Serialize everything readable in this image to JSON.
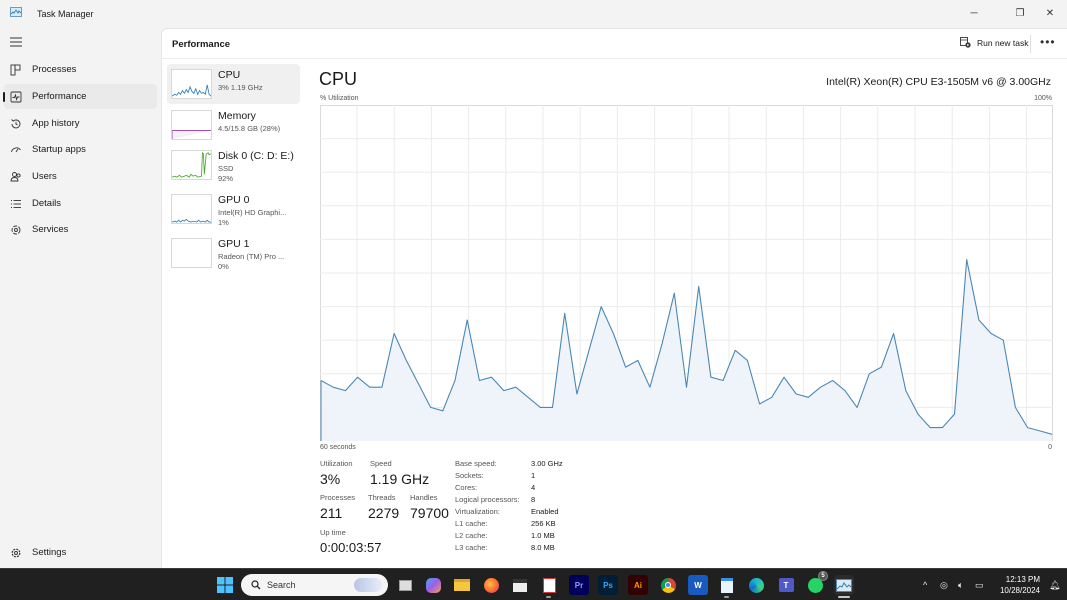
{
  "window": {
    "title": "Task Manager",
    "controls": {
      "minimize": "─",
      "maximize": "❐",
      "close": "✕"
    }
  },
  "sidebar": {
    "menu_icon": "hamburger-icon",
    "items": [
      {
        "label": "Processes",
        "icon": "processes-icon",
        "active": false
      },
      {
        "label": "Performance",
        "icon": "performance-icon",
        "active": true
      },
      {
        "label": "App history",
        "icon": "history-icon",
        "active": false
      },
      {
        "label": "Startup apps",
        "icon": "startup-icon",
        "active": false
      },
      {
        "label": "Users",
        "icon": "users-icon",
        "active": false
      },
      {
        "label": "Details",
        "icon": "details-icon",
        "active": false
      },
      {
        "label": "Services",
        "icon": "services-icon",
        "active": false
      }
    ],
    "settings_label": "Settings"
  },
  "header": {
    "title": "Performance",
    "run_new_task": "Run new task",
    "more": "•••"
  },
  "devices": [
    {
      "name": "CPU",
      "line1": "3%  1.19 GHz",
      "line2": "",
      "color": "#2f7fb6"
    },
    {
      "name": "Memory",
      "line1": "4.5/15.8 GB (28%)",
      "line2": "",
      "color": "#8b3a9e"
    },
    {
      "name": "Disk 0 (C: D: E:)",
      "line1": "SSD",
      "line2": "92%",
      "color": "#4ca82c"
    },
    {
      "name": "GPU 0",
      "line1": "Intel(R) HD Graphi...",
      "line2": "1%",
      "color": "#2f7fb6"
    },
    {
      "name": "GPU 1",
      "line1": "Radeon (TM) Pro ...",
      "line2": "0%",
      "color": "#2f7fb6"
    }
  ],
  "cpu": {
    "title": "CPU",
    "model": "Intel(R) Xeon(R) CPU E3-1505M v6 @ 3.00GHz",
    "stats": {
      "utilization_label": "Utilization",
      "utilization": "3%",
      "speed_label": "Speed",
      "speed": "1.19 GHz",
      "processes_label": "Processes",
      "processes": "211",
      "threads_label": "Threads",
      "threads": "2279",
      "handles_label": "Handles",
      "handles": "79700",
      "uptime_label": "Up time",
      "uptime": "0:00:03:57"
    },
    "specs": [
      {
        "label": "Base speed:",
        "value": "3.00 GHz"
      },
      {
        "label": "Sockets:",
        "value": "1"
      },
      {
        "label": "Cores:",
        "value": "4"
      },
      {
        "label": "Logical processors:",
        "value": "8"
      },
      {
        "label": "Virtualization:",
        "value": "Enabled"
      },
      {
        "label": "L1 cache:",
        "value": "256 KB"
      },
      {
        "label": "L2 cache:",
        "value": "1.0 MB"
      },
      {
        "label": "L3 cache:",
        "value": "8.0 MB"
      }
    ]
  },
  "chart_data": {
    "type": "area",
    "title": "CPU",
    "ylabel": "% Utilization",
    "ymax_label": "100%",
    "xlabel_left": "60 seconds",
    "xlabel_right": "0",
    "ylim": [
      0,
      100
    ],
    "xlim": [
      60,
      0
    ],
    "grid": true,
    "line_color": "#4a88b5",
    "fill_color": "#eef4fa",
    "series": [
      {
        "name": "CPU utilization",
        "x_seconds_ago": [
          60,
          59,
          58,
          57,
          56,
          55,
          54,
          53,
          52,
          51,
          50,
          49,
          48,
          47,
          46,
          45,
          44,
          43,
          42,
          41,
          40,
          39,
          38,
          37,
          36,
          35,
          34,
          33,
          32,
          31,
          30,
          29,
          28,
          27,
          26,
          25,
          24,
          23,
          22,
          21,
          20,
          19,
          18,
          17,
          16,
          15,
          14,
          13,
          12,
          11,
          10,
          9,
          8,
          7,
          6,
          5,
          4,
          3,
          2,
          1,
          0
        ],
        "values": [
          18,
          16,
          15,
          19,
          16,
          16,
          32,
          24,
          17,
          10,
          9,
          18,
          36,
          18,
          19,
          15,
          16,
          13,
          10,
          10,
          38,
          14,
          27,
          40,
          32,
          22,
          24,
          16,
          29,
          44,
          16,
          46,
          19,
          18,
          27,
          24,
          11,
          13,
          19,
          14,
          13,
          16,
          18,
          15,
          10,
          20,
          22,
          32,
          15,
          8,
          4,
          4,
          8,
          54,
          36,
          32,
          30,
          10,
          4,
          3,
          2
        ]
      }
    ]
  },
  "taskbar": {
    "search_placeholder": "Search",
    "apps": [
      {
        "name": "start-button",
        "label": ""
      },
      {
        "name": "task-view",
        "label": ""
      },
      {
        "name": "copilot",
        "label": ""
      },
      {
        "name": "file-explorer",
        "label": ""
      },
      {
        "name": "firefox",
        "label": ""
      },
      {
        "name": "clapper",
        "label": ""
      },
      {
        "name": "snipping-tool",
        "label": ""
      },
      {
        "name": "premiere-pro",
        "label": "Pr"
      },
      {
        "name": "photoshop",
        "label": "Ps"
      },
      {
        "name": "illustrator",
        "label": "Ai"
      },
      {
        "name": "chrome",
        "label": ""
      },
      {
        "name": "word",
        "label": "W"
      },
      {
        "name": "notepad",
        "label": ""
      },
      {
        "name": "edge",
        "label": ""
      },
      {
        "name": "teams",
        "label": "T"
      },
      {
        "name": "whatsapp",
        "label": ""
      },
      {
        "name": "task-manager",
        "label": ""
      }
    ],
    "whatsapp_badge": "5",
    "tray_chevron": "^",
    "time": "12:13 PM",
    "date": "10/28/2024"
  }
}
